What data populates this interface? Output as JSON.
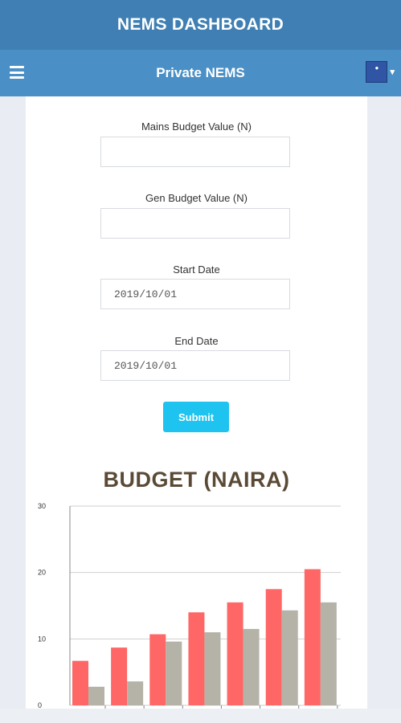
{
  "header": {
    "title": "NEMS DASHBOARD"
  },
  "subheader": {
    "title": "Private NEMS",
    "menu_icon": "hamburger-menu-icon",
    "avatar_icon": "user-avatar-icon"
  },
  "form": {
    "mains_label": "Mains Budget Value (N)",
    "mains_value": "",
    "gen_label": "Gen Budget Value (N)",
    "gen_value": "",
    "start_label": "Start Date",
    "start_value": "2019/10/01",
    "end_label": "End Date",
    "end_value": "2019/10/01",
    "submit_label": "Submit"
  },
  "colors": {
    "accent": "#1ec3ef",
    "topbar": "#3f7fb3",
    "subbar": "#4a8fc5",
    "series_a": "#ff6666",
    "series_b": "#b5b2a8"
  },
  "chart_data": {
    "type": "bar",
    "title": "BUDGET (NAIRA)",
    "ylim": [
      0,
      30
    ],
    "yticks": [
      "0",
      "10",
      "20",
      "30"
    ],
    "categories": [
      "",
      "",
      "",
      "",
      "",
      "",
      ""
    ],
    "series": [
      {
        "values": [
          6.7,
          8.7,
          10.7,
          14,
          15.5,
          17.5,
          20.5
        ]
      },
      {
        "values": [
          2.8,
          3.6,
          9.6,
          11,
          11.5,
          14.3,
          15.5
        ]
      }
    ],
    "grid": true
  }
}
